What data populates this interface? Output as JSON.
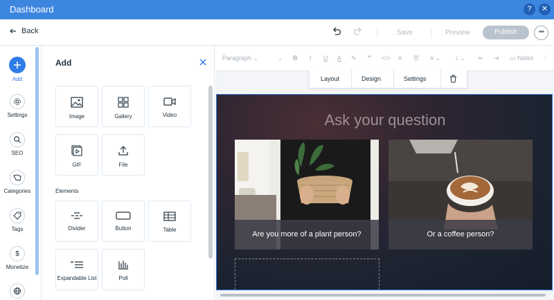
{
  "window": {
    "title": "Dashboard",
    "help_label": "?",
    "close_label": "✕"
  },
  "topbar": {
    "back_label": "Back",
    "save_label": "Save",
    "preview_label": "Preview",
    "publish_label": "Publish",
    "more_label": "•••"
  },
  "rail": {
    "items": [
      {
        "label": "Add",
        "icon": "plus-icon",
        "active": true
      },
      {
        "label": "Settings",
        "icon": "gear-icon"
      },
      {
        "label": "SEO",
        "icon": "search-icon"
      },
      {
        "label": "Categories",
        "icon": "categories-icon"
      },
      {
        "label": "Tags",
        "icon": "tag-icon"
      },
      {
        "label": "Monetize",
        "icon": "dollar-icon"
      },
      {
        "label": "",
        "icon": "globe-icon"
      }
    ]
  },
  "panel": {
    "title": "Add",
    "media_tiles": [
      {
        "label": "Image",
        "icon": "image-icon"
      },
      {
        "label": "Gallery",
        "icon": "gallery-icon"
      },
      {
        "label": "Video",
        "icon": "video-icon"
      },
      {
        "label": "GIF",
        "icon": "gif-icon"
      },
      {
        "label": "File",
        "icon": "file-upload-icon"
      }
    ],
    "elements_heading": "Elements",
    "element_tiles": [
      {
        "label": "Divider",
        "icon": "divider-icon"
      },
      {
        "label": "Button",
        "icon": "button-icon"
      },
      {
        "label": "Table",
        "icon": "table-icon"
      },
      {
        "label": "Expandable List",
        "icon": "expandable-list-icon"
      },
      {
        "label": "Poll",
        "icon": "poll-icon"
      }
    ]
  },
  "format_toolbar": {
    "paragraph_label": "Paragraph",
    "notes_label": "Notes"
  },
  "context_toolbar": {
    "layout_label": "Layout",
    "design_label": "Design",
    "settings_label": "Settings"
  },
  "poll": {
    "question": "Ask your question",
    "options": [
      {
        "label": "Are you more of a plant person?"
      },
      {
        "label": "Or a coffee person?"
      }
    ]
  },
  "colors": {
    "titlebar": "#3d86e0",
    "accent": "#2f7de8",
    "selection": "#3a7fe6",
    "publish_disabled": "#b9c3cd"
  }
}
